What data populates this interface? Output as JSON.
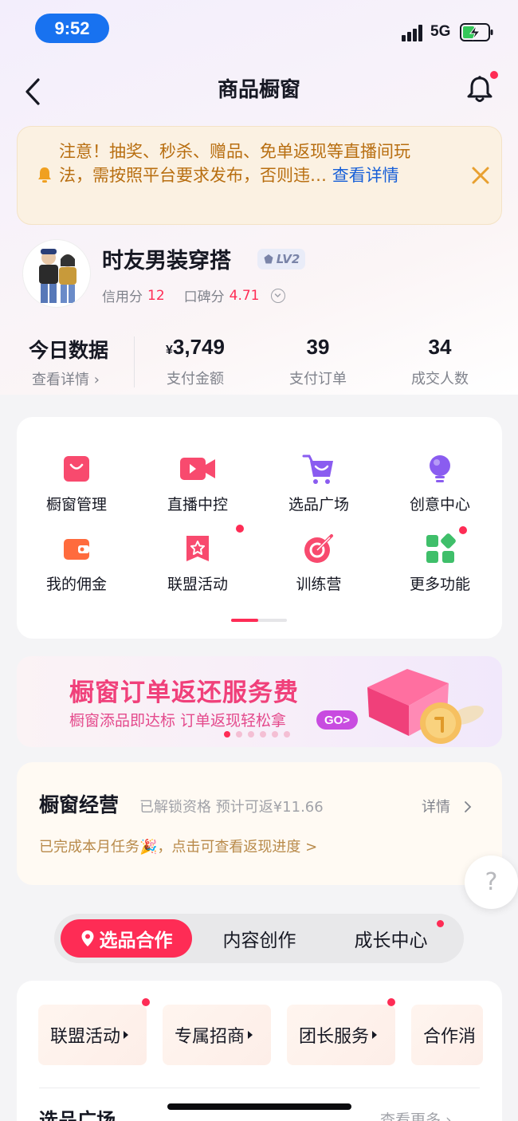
{
  "status_bar": {
    "time": "9:52",
    "network": "5G"
  },
  "nav": {
    "title": "商品橱窗"
  },
  "notice": {
    "text": "注意！抽奖、秒杀、赠品、免单返现等直播间玩法，需按照平台要求发布，否则违…",
    "link": "查看详情"
  },
  "profile": {
    "name": "时友男装穿搭",
    "level": "LV2",
    "credit_label": "信用分",
    "credit_value": "12",
    "reputation_label": "口碑分",
    "reputation_value": "4.71"
  },
  "today": {
    "title": "今日数据",
    "link": "查看详情 ›",
    "stats": [
      {
        "currency": "¥",
        "value": "3,749",
        "label": "支付金额"
      },
      {
        "value": "39",
        "label": "支付订单"
      },
      {
        "value": "34",
        "label": "成交人数"
      }
    ]
  },
  "functions": [
    {
      "label": "橱窗管理",
      "icon": "shopping-bag-icon",
      "dot": false
    },
    {
      "label": "直播中控",
      "icon": "video-camera-icon",
      "dot": false
    },
    {
      "label": "选品广场",
      "icon": "shopping-cart-icon",
      "dot": false
    },
    {
      "label": "创意中心",
      "icon": "lightbulb-icon",
      "dot": false
    },
    {
      "label": "我的佣金",
      "icon": "wallet-icon",
      "dot": false
    },
    {
      "label": "联盟活动",
      "icon": "star-badge-icon",
      "dot": true
    },
    {
      "label": "训练营",
      "icon": "target-icon",
      "dot": false
    },
    {
      "label": "更多功能",
      "icon": "grid-icon",
      "dot": true
    }
  ],
  "banner": {
    "title": "橱窗订单返还服务费",
    "subtitle": "橱窗添品即达标 订单返现轻松拿",
    "cta": "GO>",
    "active_dot": 0,
    "dot_count": 6
  },
  "operations": {
    "title": "橱窗经营",
    "subtitle": "已解锁资格 预计可返¥11.66",
    "detail": "详情",
    "progress": "已完成本月任务🎉，点击可查看返现进度 >"
  },
  "help": "?",
  "tabs": [
    {
      "label": "选品合作",
      "active": true
    },
    {
      "label": "内容创作",
      "active": false
    },
    {
      "label": "成长中心",
      "active": false,
      "dot": true
    }
  ],
  "chips": [
    {
      "label": "联盟活动",
      "dot": true
    },
    {
      "label": "专属招商",
      "dot": false
    },
    {
      "label": "团长服务",
      "dot": true
    },
    {
      "label": "合作消",
      "dot": false
    }
  ],
  "section": {
    "title": "选品广场",
    "more": "查看更多 ›"
  },
  "colors": {
    "accent": "#fe2c55",
    "link": "#1860d8",
    "notice_text": "#b86e10"
  }
}
